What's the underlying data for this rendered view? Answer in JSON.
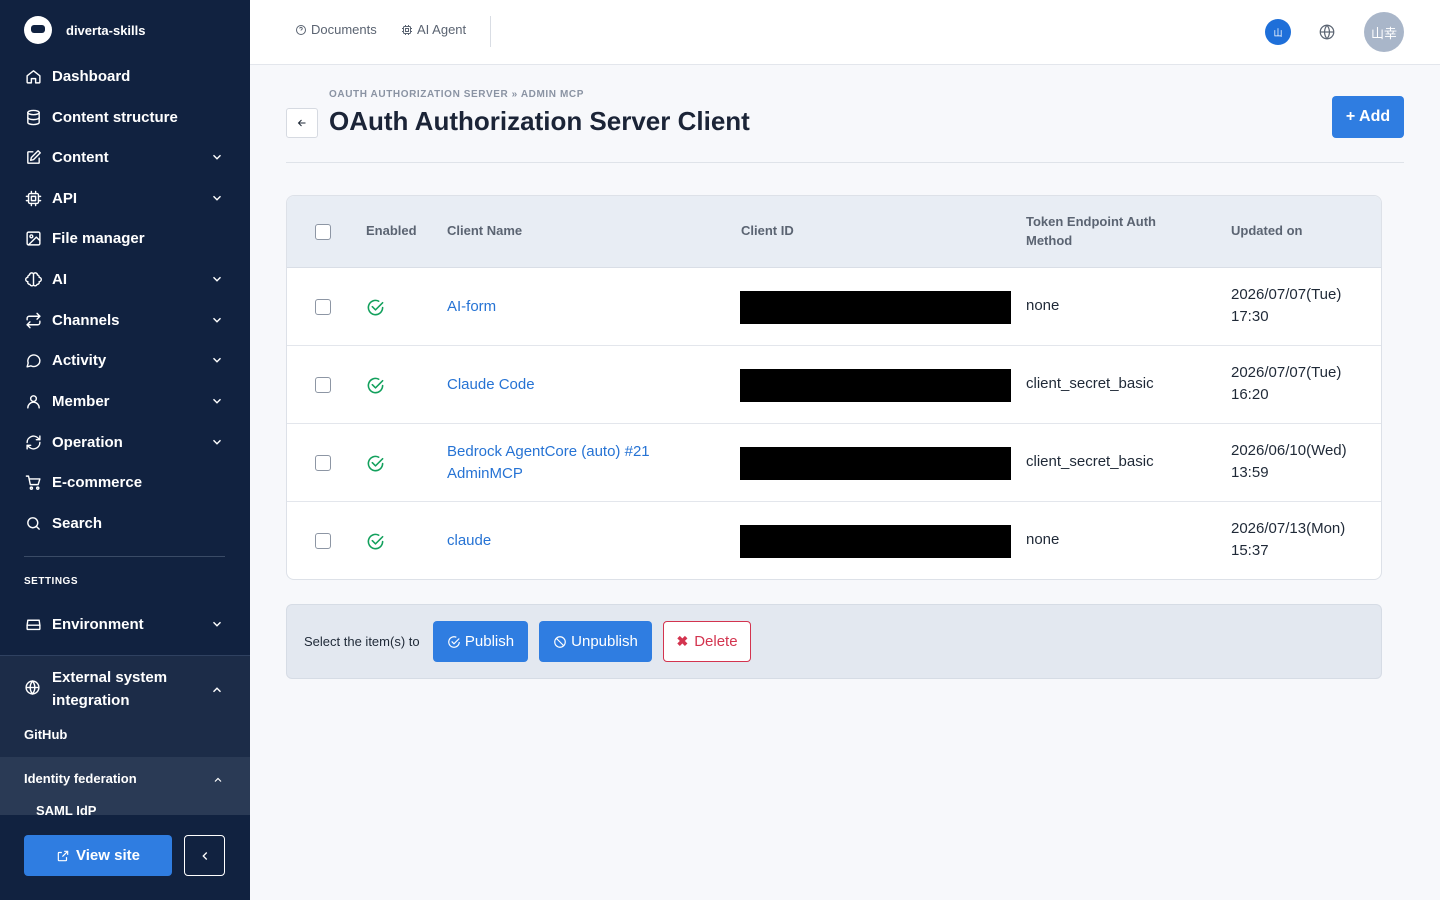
{
  "sidebar": {
    "brand": "diverta-skills",
    "items": [
      {
        "label": "Dashboard"
      },
      {
        "label": "Content structure"
      },
      {
        "label": "Content"
      },
      {
        "label": "API"
      },
      {
        "label": "File manager"
      },
      {
        "label": "AI"
      },
      {
        "label": "Channels"
      },
      {
        "label": "Activity"
      },
      {
        "label": "Member"
      },
      {
        "label": "Operation"
      },
      {
        "label": "E-commerce"
      },
      {
        "label": "Search"
      }
    ],
    "settings_label": "SETTINGS",
    "environment": "Environment",
    "external": "External system integration",
    "github": "GitHub",
    "identity_federation": "Identity federation",
    "saml": "SAML IdP",
    "view_site": "View site"
  },
  "topbar": {
    "documents": "Documents",
    "ai_agent": "AI Agent",
    "badge": "山",
    "avatar": "山幸"
  },
  "page": {
    "breadcrumb": "OAUTH AUTHORIZATION SERVER » ADMIN MCP",
    "title": "OAuth Authorization Server Client",
    "add_label": "+ Add"
  },
  "table": {
    "headers": {
      "enabled": "Enabled",
      "client_name": "Client Name",
      "client_id": "Client ID",
      "auth_method": "Token Endpoint Auth Method",
      "updated": "Updated on"
    },
    "rows": [
      {
        "name": "AI-form",
        "auth": "none",
        "date": "2026/07/07(Tue)",
        "time": "17:30"
      },
      {
        "name": "Claude Code",
        "auth": "client_secret_basic",
        "date": "2026/07/07(Tue)",
        "time": "16:20"
      },
      {
        "name": "Bedrock AgentCore (auto) #21 AdminMCP",
        "auth": "client_secret_basic",
        "date": "2026/06/10(Wed)",
        "time": "13:59"
      },
      {
        "name": "claude",
        "auth": "none",
        "date": "2026/07/13(Mon)",
        "time": "15:37"
      }
    ]
  },
  "bulk": {
    "label": "Select the item(s) to",
    "publish": "Publish",
    "unpublish": "Unpublish",
    "delete": "Delete"
  },
  "colors": {
    "sidebar_bg": "#112240",
    "accent": "#2f7de1",
    "link": "#2673d4",
    "success": "#12a05c",
    "danger": "#d3344f"
  }
}
